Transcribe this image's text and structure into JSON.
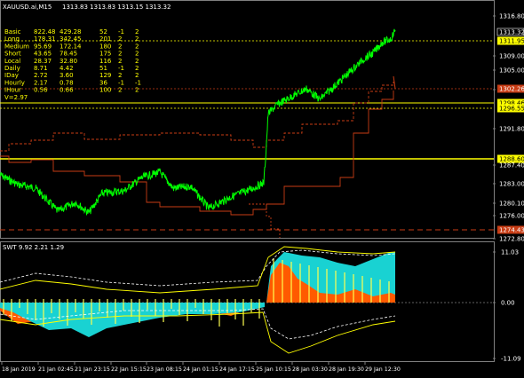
{
  "header": {
    "symbol_tf": "XAUUSD.ai,M15",
    "ohlc": "1313.83 1313.83 1313.15 1313.32"
  },
  "stats_table": {
    "rows": [
      [
        "Basic",
        "822.48",
        "429.28",
        "52",
        "-1",
        "2"
      ],
      [
        "Long",
        "178.31",
        "342.45",
        "201",
        "2",
        "2"
      ],
      [
        "Medium",
        "95.69",
        "172.14",
        "180",
        "2",
        "2"
      ],
      [
        "Short",
        "43.65",
        "78.45",
        "175",
        "2",
        "2"
      ],
      [
        "Local",
        "28.37",
        "32.80",
        "116",
        "2",
        "2"
      ],
      [
        "Daily",
        "8.71",
        "4.42",
        "51",
        "-1",
        "2"
      ],
      [
        "IDay",
        "2.72",
        "3.60",
        "129",
        "2",
        "2"
      ],
      [
        "Hourly",
        "2.17",
        "0.78",
        "36",
        "-1",
        "-1"
      ],
      [
        "IHour",
        "0.56",
        "0.66",
        "100",
        "2",
        "2"
      ]
    ],
    "footer": "V=2.97"
  },
  "price_axis": {
    "ticks": [
      "1316.80",
      "1309.00",
      "1305.00",
      "1298.40",
      "1291.80",
      "1287.40",
      "1283.00",
      "1280.10",
      "1276.00",
      "1272.80"
    ],
    "current_price": "1313.32",
    "labels": [
      {
        "text": "1311.95",
        "bg": "#ffff00",
        "fg": "#000000"
      },
      {
        "text": "1302.26",
        "bg": "#c83c14",
        "fg": "#ffffff"
      },
      {
        "text": "1298.46",
        "bg": "#ffff00",
        "fg": "#000000"
      },
      {
        "text": "1296.55",
        "bg": "#ffff00",
        "fg": "#000000"
      },
      {
        "text": "1288.60",
        "bg": "#ffff00",
        "fg": "#000000"
      },
      {
        "text": "1274.43",
        "bg": "#c83c14",
        "fg": "#ffffff"
      }
    ]
  },
  "indicator": {
    "title": "SWT 9.92 2.21 1.29",
    "ticks": [
      "11.03",
      "0.00",
      "-11.09"
    ]
  },
  "time_axis": {
    "labels": [
      "18 Jan 2019",
      "21 Jan 02:45",
      "21 Jan 23:15",
      "22 Jan 15:15",
      "23 Jan 08:15",
      "24 Jan 01:15",
      "24 Jan 17:15",
      "25 Jan 10:15",
      "28 Jan 03:30",
      "28 Jan 19:30",
      "29 Jan 12:30"
    ]
  },
  "colors": {
    "background": "#000000",
    "price": "#00ff00",
    "level_yellow": "#ffff00",
    "level_red": "#c83c14",
    "hist_orange": "#ff5a00",
    "hist_cyan": "#19d2d2",
    "hist_yellow": "#ffff50"
  }
}
